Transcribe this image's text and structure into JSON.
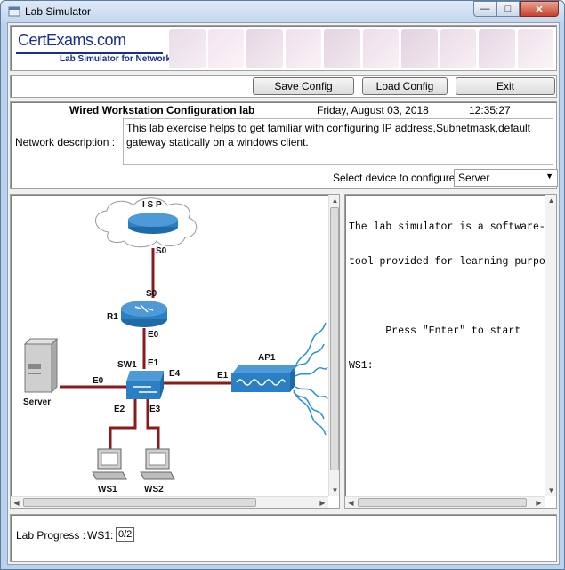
{
  "window": {
    "title": "Lab Simulator"
  },
  "logo": {
    "brand": "CertExams.com",
    "subtitle": "Lab Simulator for Network+"
  },
  "toolbar": {
    "save_label": "Save Config",
    "load_label": "Load Config",
    "exit_label": "Exit"
  },
  "lab": {
    "title": "Wired Workstation Configuration lab",
    "date": "Friday, August 03, 2018",
    "time": "12:35:27",
    "description_label": "Network description :",
    "description": "This lab exercise helps to get familiar with configuring IP address,Subnetmask,default gateway statically on a windows client.",
    "device_label": "Select device to configure :",
    "device_selected": "Server"
  },
  "network": {
    "isp_label": "I S P",
    "isp_port": "S0",
    "r1_label": "R1",
    "r1_port_s0": "S0",
    "r1_port_e0": "E0",
    "sw1_label": "SW1",
    "sw1_e1": "E1",
    "sw1_e2": "E2",
    "sw1_e3": "E3",
    "sw1_e4": "E4",
    "server_label": "Server",
    "server_port": "E0",
    "ap1_label": "AP1",
    "ap1_port": "E1",
    "ws1_label": "WS1",
    "ws2_label": "WS2"
  },
  "console": {
    "lines": [
      "The lab simulator is a software-ba",
      "tool provided for learning purpose",
      "",
      "      Press \"Enter\" to start",
      "WS1:"
    ]
  },
  "progress": {
    "label": "Lab Progress :",
    "ws_label": "WS1:",
    "value": "0/2"
  },
  "colors": {
    "link": "#8b1a1a",
    "router": "#2b7fc4",
    "brand": "#1a2f8c",
    "close": "#c7432b"
  }
}
